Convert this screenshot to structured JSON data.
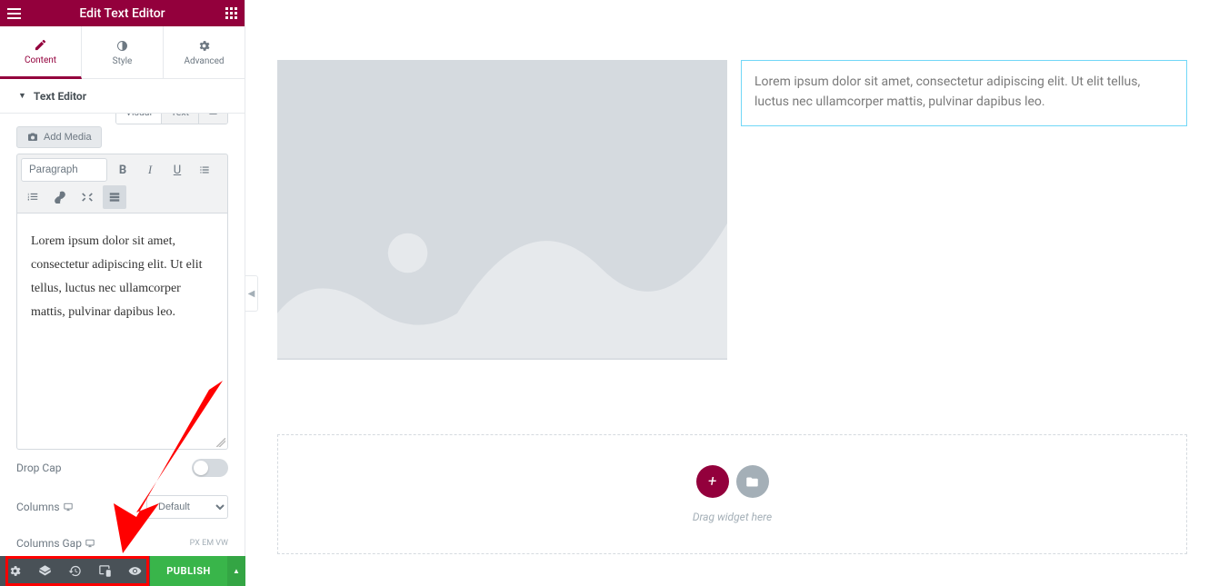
{
  "header": {
    "title": "Edit Text Editor"
  },
  "tabs": {
    "content": "Content",
    "style": "Style",
    "advanced": "Advanced"
  },
  "section": {
    "title": "Text Editor"
  },
  "editor": {
    "add_media": "Add Media",
    "tab_visual": "Visual",
    "tab_text": "Text",
    "format": "Paragraph",
    "content": "Lorem ipsum dolor sit amet, consectetur adipiscing elit. Ut elit tellus, luctus nec ullamcorper mattis, pulvinar dapibus leo."
  },
  "controls": {
    "dropcap": "Drop Cap",
    "columns": "Columns",
    "columns_gap": "Columns Gap",
    "default": "Default",
    "units": "PX  EM  VW"
  },
  "footer": {
    "publish": "PUBLISH"
  },
  "preview": {
    "text": "Lorem ipsum dolor sit amet, consectetur adipiscing elit. Ut elit tellus, luctus nec ullamcorper mattis, pulvinar dapibus leo.",
    "drop_hint": "Drag widget here"
  }
}
